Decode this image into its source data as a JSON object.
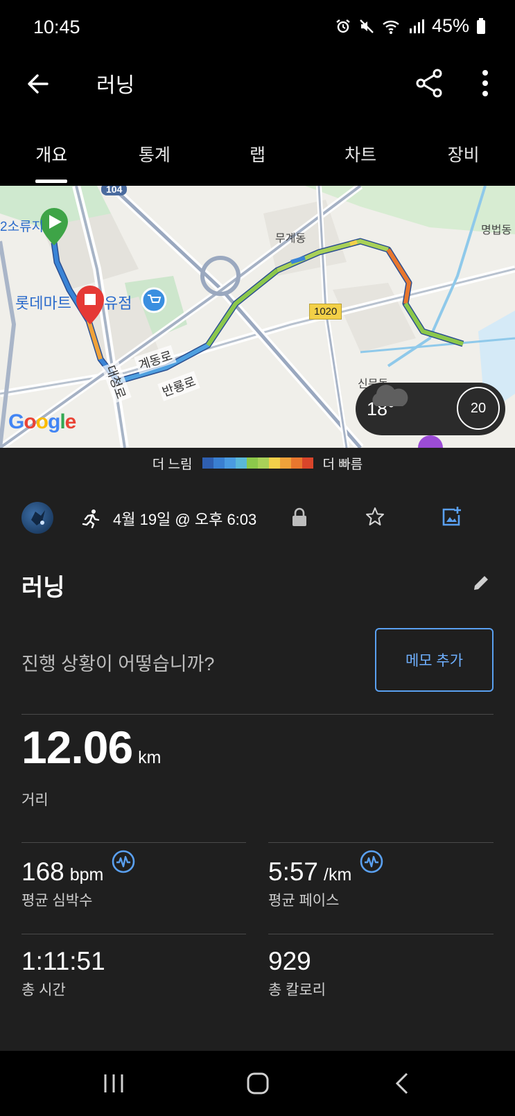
{
  "status": {
    "time": "10:45",
    "battery": "45%"
  },
  "app_bar": {
    "title": "러닝"
  },
  "tabs": [
    {
      "label": "개요",
      "active": true
    },
    {
      "label": "통계",
      "active": false
    },
    {
      "label": "랩",
      "active": false
    },
    {
      "label": "차트",
      "active": false
    },
    {
      "label": "장비",
      "active": false
    }
  ],
  "map": {
    "labels": {
      "area1": "무계동",
      "area2": "명법동",
      "area3": "신문동",
      "area4": "2소류지",
      "road1": "계동로",
      "road2": "반룡로",
      "road3": "대청로",
      "poi": "롯데마트",
      "poi_suffix": "유점",
      "route_badge": "1020",
      "hwy_badge": "104"
    },
    "google": "Google",
    "weather": {
      "temp": "18°",
      "wind": "20"
    }
  },
  "legend": {
    "slow": "더 느림",
    "fast": "더 빠름",
    "colors": [
      "#2f5fb0",
      "#3a7fd0",
      "#4a9be0",
      "#5ab8d8",
      "#8cc84b",
      "#a9d158",
      "#f2d04a",
      "#f0a23a",
      "#e8772e",
      "#d8452a"
    ]
  },
  "meta": {
    "date": "4월 19일 @ 오후 6:03"
  },
  "activity": {
    "name": "러닝",
    "prompt": "진행 상황이 어떻습니까?",
    "memo_button": "메모 추가"
  },
  "stats": {
    "distance": {
      "value": "12.06",
      "unit": "km",
      "label": "거리"
    },
    "heart_rate": {
      "value": "168",
      "unit": "bpm",
      "label": "평균 심박수"
    },
    "pace": {
      "value": "5:57",
      "unit": "/km",
      "label": "평균 페이스"
    },
    "time": {
      "value": "1:11:51",
      "label": "총 시간"
    },
    "calories": {
      "value": "929",
      "label": "총 칼로리"
    }
  }
}
